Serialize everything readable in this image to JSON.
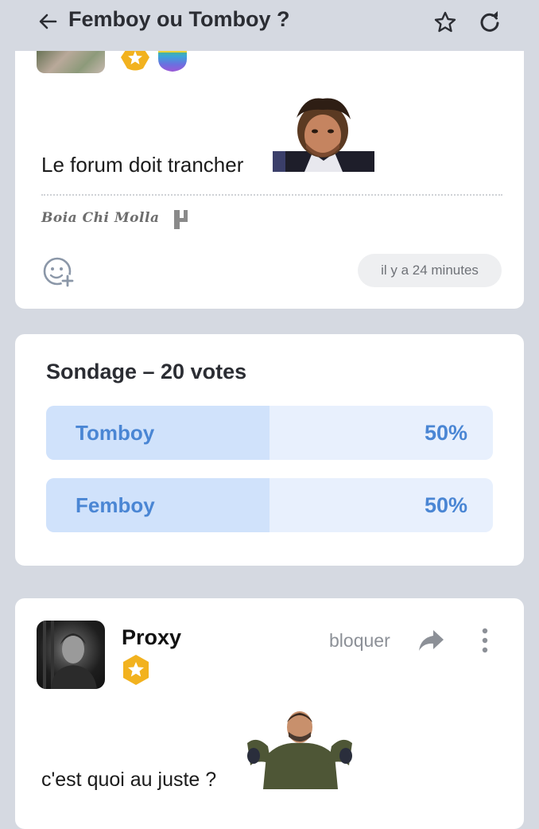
{
  "header": {
    "title": "Femboy ou Tomboy ?",
    "icons": [
      "back-arrow-icon",
      "star-icon",
      "reload-icon"
    ]
  },
  "post1": {
    "message": "Le forum doit trancher",
    "signature": "Boia Chi Molla",
    "time": "il y a 24 minutes"
  },
  "poll": {
    "title": "Sondage – 20 votes",
    "options": [
      {
        "label": "Tomboy",
        "percent_text": "50%",
        "percent": 50
      },
      {
        "label": "Femboy",
        "percent_text": "50%",
        "percent": 50
      }
    ]
  },
  "post2": {
    "username": "Proxy",
    "block_label": "bloquer",
    "message": "c'est quoi au juste ?"
  },
  "colors": {
    "background": "#d5d9e1",
    "card": "#ffffff",
    "accent": "#4a86d4",
    "poll_fill": "#d0e2fb",
    "poll_track": "#e8f0fd",
    "badge_gold": "#f2b21f"
  }
}
